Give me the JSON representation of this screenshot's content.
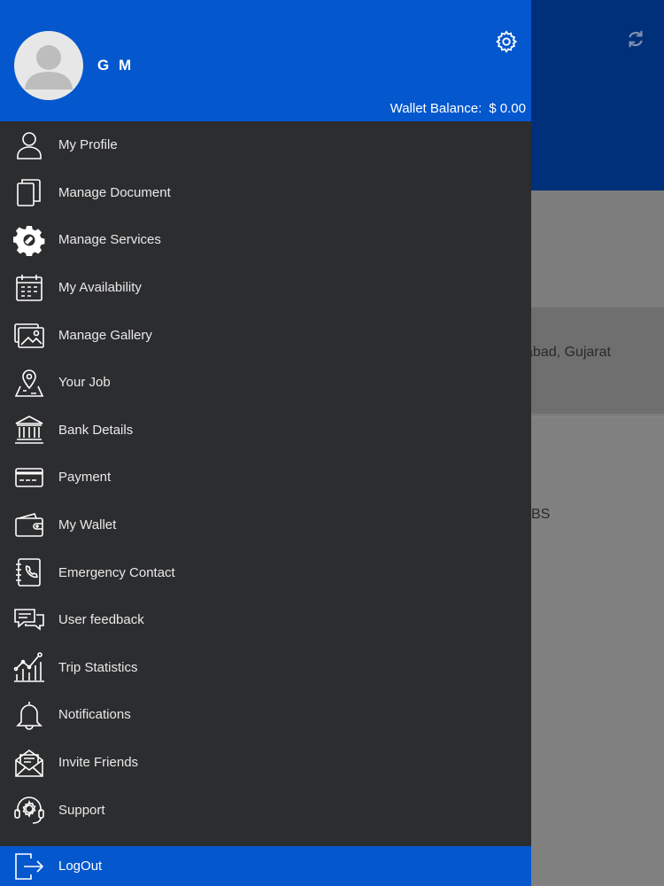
{
  "background": {
    "location_text": "abad,  Gujarat",
    "partial_text": "BS"
  },
  "drawer": {
    "user_name": "G M",
    "wallet_label": "Wallet Balance:",
    "wallet_amount": "$ 0.00",
    "menu": [
      {
        "label": "My Profile",
        "icon": "user-icon"
      },
      {
        "label": "Manage Document",
        "icon": "document-icon"
      },
      {
        "label": "Manage Services",
        "icon": "services-gear-icon"
      },
      {
        "label": "My Availability",
        "icon": "calendar-icon"
      },
      {
        "label": "Manage Gallery",
        "icon": "gallery-icon"
      },
      {
        "label": "Your Job",
        "icon": "map-pin-icon"
      },
      {
        "label": "Bank Details",
        "icon": "bank-icon"
      },
      {
        "label": "Payment",
        "icon": "credit-card-icon"
      },
      {
        "label": "My Wallet",
        "icon": "wallet-icon"
      },
      {
        "label": "Emergency Contact",
        "icon": "phone-book-icon"
      },
      {
        "label": "User feedback",
        "icon": "chat-bubbles-icon"
      },
      {
        "label": "Trip Statistics",
        "icon": "chart-icon"
      },
      {
        "label": "Notifications",
        "icon": "bell-icon"
      },
      {
        "label": "Invite Friends",
        "icon": "envelope-icon"
      },
      {
        "label": "Support",
        "icon": "headset-icon"
      }
    ],
    "logout_label": "LogOut"
  },
  "colors": {
    "header_blue": "#0457cd",
    "drawer_bg": "#2c2d2f",
    "bg_header": "#00307a"
  }
}
